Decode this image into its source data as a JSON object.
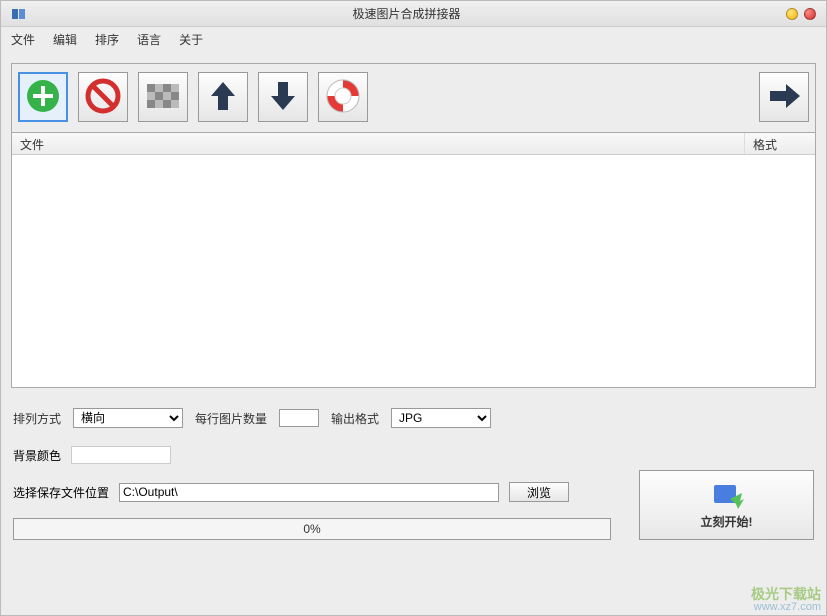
{
  "window": {
    "title": "极速图片合成拼接器"
  },
  "menu": {
    "file": "文件",
    "edit": "编辑",
    "sort": "排序",
    "language": "语言",
    "about": "关于"
  },
  "listHeader": {
    "file": "文件",
    "format": "格式"
  },
  "options": {
    "arrangementLabel": "排列方式",
    "arrangementValue": "横向",
    "perRowLabel": "每行图片数量",
    "perRowValue": "",
    "outputFormatLabel": "输出格式",
    "outputFormatValue": "JPG"
  },
  "bgcolor": {
    "label": "背景颜色",
    "value": "#ffffff"
  },
  "savepath": {
    "label": "选择保存文件位置",
    "value": "C:\\Output\\",
    "browse": "浏览"
  },
  "progress": {
    "text": "0%"
  },
  "start": {
    "label": "立刻开始!"
  },
  "watermark": {
    "line1": "极光下载站",
    "line2": "www.xz7.com"
  },
  "icons": {
    "add": "add-icon",
    "remove": "remove-icon",
    "clear": "clear-icon",
    "moveUp": "arrow-up-icon",
    "moveDown": "arrow-down-icon",
    "help": "lifebuoy-icon",
    "proceed": "arrow-right-icon"
  }
}
